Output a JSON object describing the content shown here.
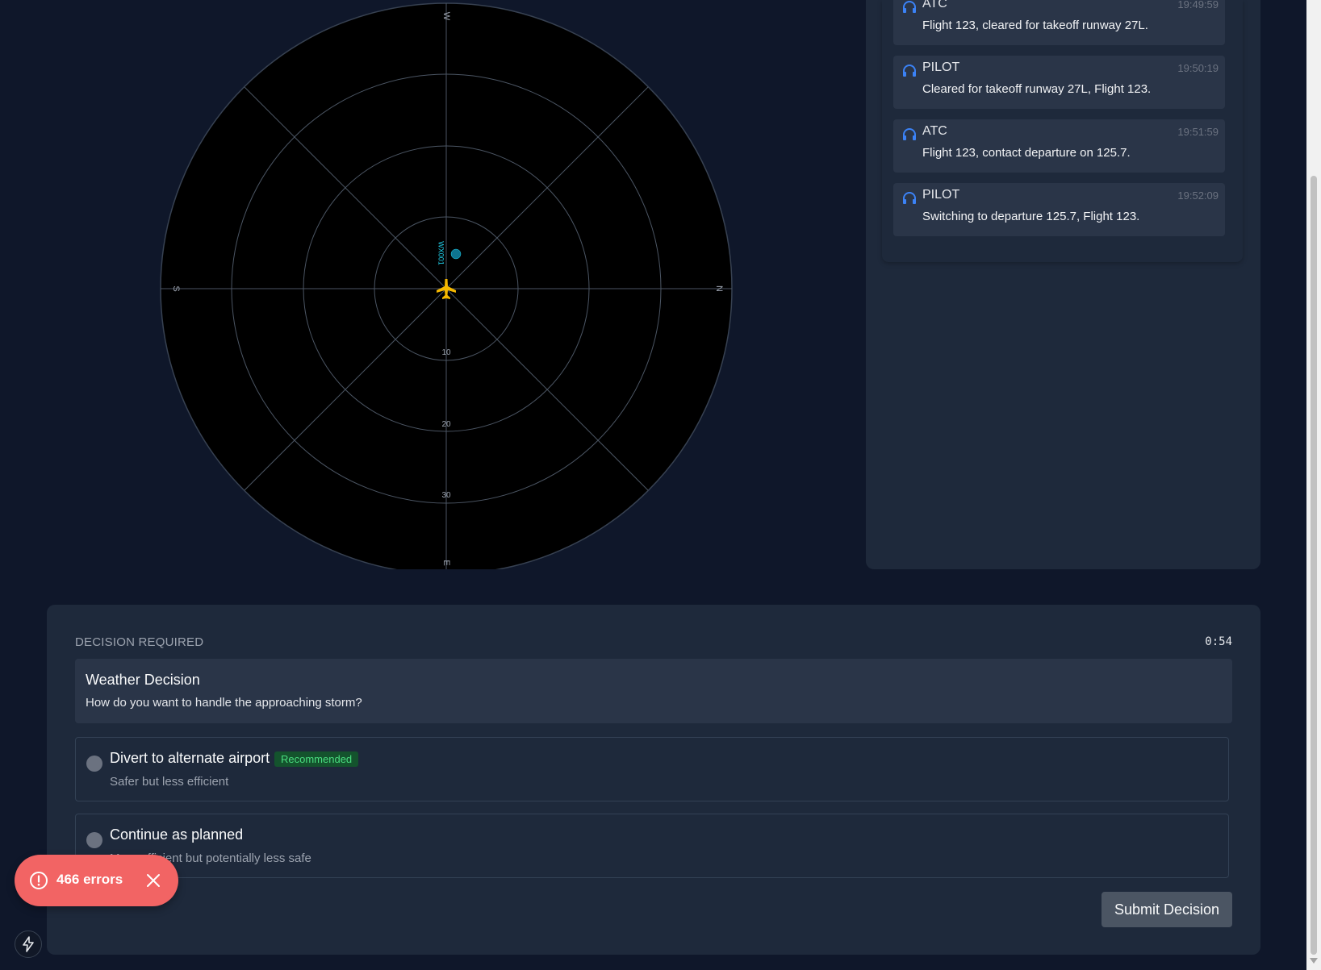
{
  "radar": {
    "compass": {
      "north": "N",
      "south": "S",
      "west": "W",
      "east": "E"
    },
    "range_labels": [
      "10",
      "20",
      "30"
    ],
    "target_label": "WX001",
    "colors": {
      "aircraft": "#f5b800",
      "target": "#0e7490",
      "grid": "#4b5563",
      "scope": "#000000"
    }
  },
  "comms": {
    "messages": [
      {
        "sender": "ATC",
        "time": "19:49:59",
        "text": "Flight 123, cleared for takeoff runway 27L."
      },
      {
        "sender": "PILOT",
        "time": "19:50:19",
        "text": "Cleared for takeoff runway 27L, Flight 123."
      },
      {
        "sender": "ATC",
        "time": "19:51:59",
        "text": "Flight 123, contact departure on 125.7."
      },
      {
        "sender": "PILOT",
        "time": "19:52:09",
        "text": "Switching to departure 125.7, Flight 123."
      }
    ],
    "icon": "headset-icon",
    "icon_color": "#3b82f6"
  },
  "decision": {
    "label": "DECISION REQUIRED",
    "timer": "0:54",
    "title": "Weather Decision",
    "question": "How do you want to handle the approaching storm?",
    "options": [
      {
        "title": "Divert to alternate airport",
        "badge": "Recommended",
        "description": "Safer but less efficient"
      },
      {
        "title": "Continue as planned",
        "description": "More efficient but potentially less safe"
      }
    ],
    "submit_label": "Submit Decision"
  },
  "error_toast": {
    "text": "466 errors",
    "color": "#f26464"
  }
}
